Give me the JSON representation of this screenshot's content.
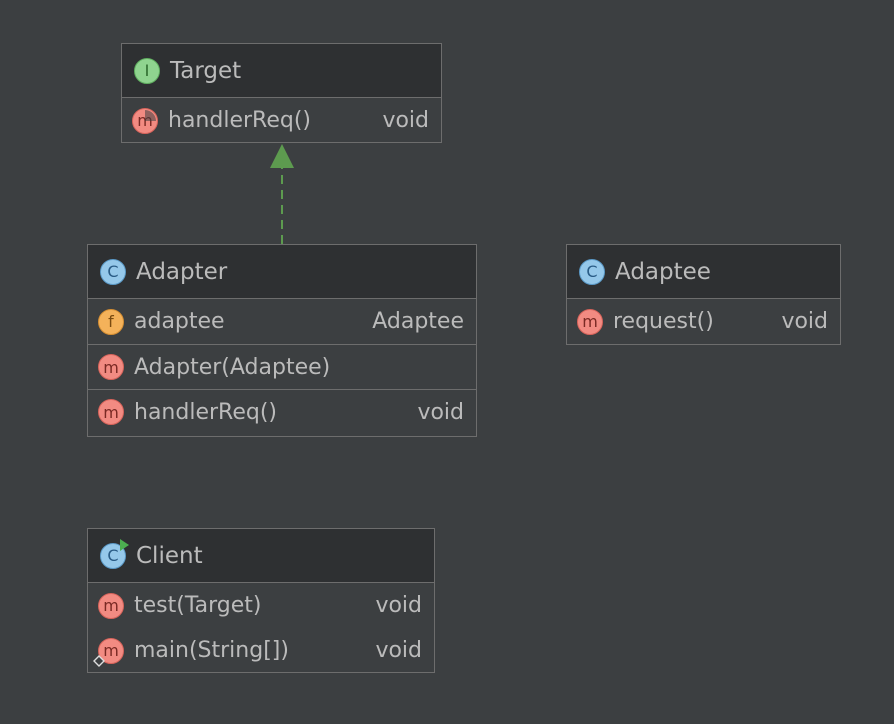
{
  "diagram": {
    "target": {
      "kind": "I",
      "name": "Target",
      "members": [
        {
          "kind": "m",
          "name": "handlerReq()",
          "type": "void"
        }
      ]
    },
    "adapter": {
      "kind": "C",
      "name": "Adapter",
      "fields": [
        {
          "kind": "f",
          "name": "adaptee",
          "type": "Adaptee"
        }
      ],
      "constructors": [
        {
          "kind": "m",
          "name": "Adapter(Adaptee)"
        }
      ],
      "methods": [
        {
          "kind": "m",
          "name": "handlerReq()",
          "type": "void"
        }
      ]
    },
    "adaptee": {
      "kind": "C",
      "name": "Adaptee",
      "methods": [
        {
          "kind": "m",
          "name": "request()",
          "type": "void"
        }
      ]
    },
    "client": {
      "kind": "C",
      "name": "Client",
      "methods": [
        {
          "kind": "m",
          "name": "test(Target)",
          "type": "void"
        },
        {
          "kind": "m",
          "name": "main(String[])",
          "type": "void"
        }
      ]
    },
    "relations": [
      {
        "from": "Adapter",
        "to": "Target",
        "type": "implements",
        "color": "#5d9b4f"
      }
    ]
  }
}
